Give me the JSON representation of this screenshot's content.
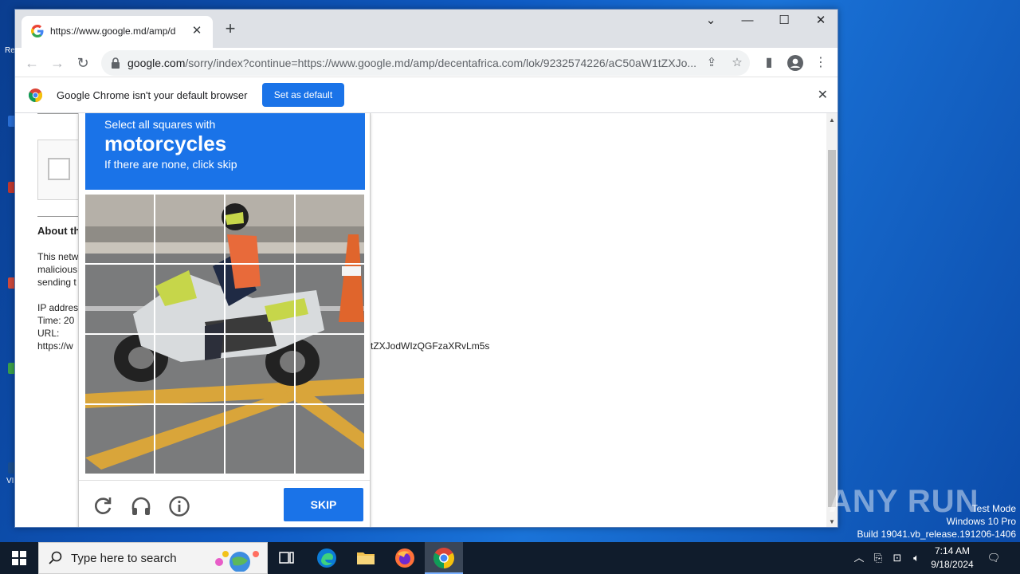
{
  "browser": {
    "tab_title": "https://www.google.md/amp/d",
    "tab_close": "✕",
    "new_tab": "+",
    "window_controls": [
      "⌄",
      "—",
      "☐",
      "✕"
    ],
    "nav": {
      "back": "←",
      "forward": "→",
      "reload": "↻"
    },
    "url_host": "google.com",
    "url_rest": "/sorry/index?continue=https://www.google.md/amp/decentafrica.com/lok/9232574226/aC50aW1tZXJo...",
    "icons": [
      "share-icon",
      "star-icon",
      "side-panel-icon",
      "profile-icon",
      "menu-icon"
    ]
  },
  "infobar": {
    "message": "Google Chrome isn't your default browser",
    "button": "Set as default",
    "close": "✕"
  },
  "sorry_page": {
    "heading": "About th",
    "para": [
      "This netw",
      "malicious",
      "sending t"
    ],
    "ip": "IP addres",
    "time": "Time: 20",
    "url_label": "URL:",
    "url_start": "https://w",
    "url_end": "tZXJodWIzQGFzaXRvLm5s"
  },
  "captcha": {
    "line1": "Select all squares with",
    "line2": "motorcycles",
    "line3": "If there are none, click skip",
    "skip": "SKIP",
    "icons": [
      "reload-icon",
      "audio-icon",
      "info-icon"
    ]
  },
  "watermark": {
    "text": "ANY RUN",
    "mode": [
      "Test Mode",
      "Windows 10 Pro",
      "Build 19041.vb_release.191206-1406"
    ]
  },
  "taskbar": {
    "search_placeholder": "Type here to search",
    "apps": [
      "task-view",
      "edge",
      "file-explorer",
      "firefox",
      "chrome"
    ],
    "time": "7:14 AM",
    "date": "9/18/2024"
  },
  "colors": {
    "accent": "#1a73e8",
    "desktop": "#0f5bc4",
    "taskbar": "#101c2c"
  }
}
